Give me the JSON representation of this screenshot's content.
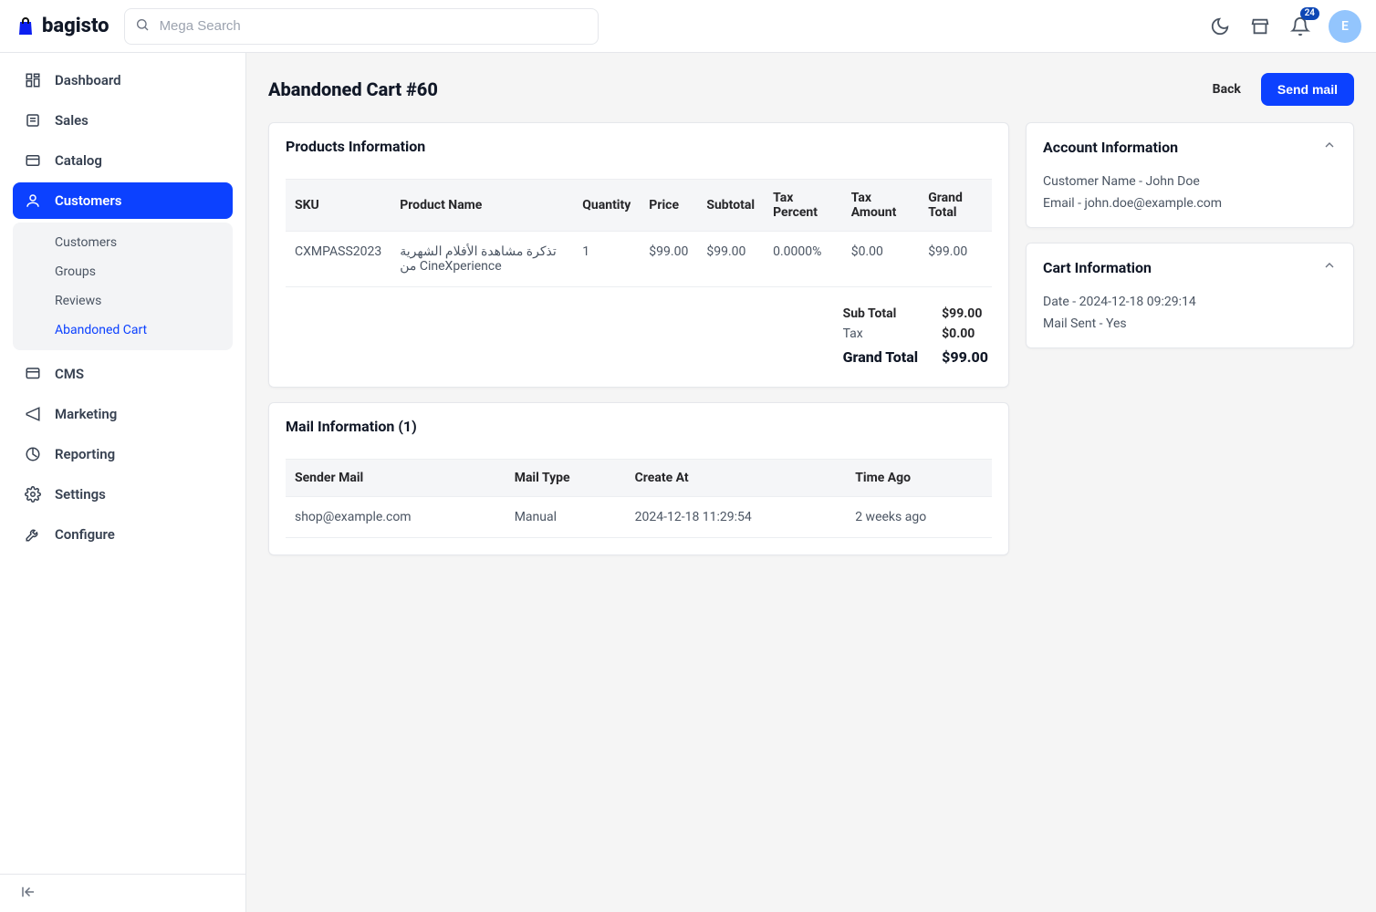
{
  "brand": "bagisto",
  "search": {
    "placeholder": "Mega Search"
  },
  "notifications": {
    "count": "24"
  },
  "avatar_initial": "E",
  "sidebar": {
    "items": [
      {
        "label": "Dashboard"
      },
      {
        "label": "Sales"
      },
      {
        "label": "Catalog"
      },
      {
        "label": "Customers"
      },
      {
        "label": "CMS"
      },
      {
        "label": "Marketing"
      },
      {
        "label": "Reporting"
      },
      {
        "label": "Settings"
      },
      {
        "label": "Configure"
      }
    ],
    "customers_sub": [
      {
        "label": "Customers"
      },
      {
        "label": "Groups"
      },
      {
        "label": "Reviews"
      },
      {
        "label": "Abandoned Cart"
      }
    ]
  },
  "page": {
    "title": "Abandoned Cart #60",
    "back": "Back",
    "send_mail": "Send mail"
  },
  "products": {
    "heading": "Products Information",
    "columns": {
      "sku": "SKU",
      "name": "Product Name",
      "qty": "Quantity",
      "price": "Price",
      "subtotal": "Subtotal",
      "tax_pct": "Tax Percent",
      "tax_amt": "Tax Amount",
      "grand": "Grand Total"
    },
    "rows": [
      {
        "sku": "CXMPASS2023",
        "name": "تذكرة مشاهدة الأفلام الشهرية من CineXperience",
        "qty": "1",
        "price": "$99.00",
        "subtotal": "$99.00",
        "tax_pct": "0.0000%",
        "tax_amt": "$0.00",
        "grand": "$99.00"
      }
    ],
    "totals": {
      "sub_total_label": "Sub Total",
      "sub_total_value": "$99.00",
      "tax_label": "Tax",
      "tax_value": "$0.00",
      "grand_label": "Grand Total",
      "grand_value": "$99.00"
    }
  },
  "mail": {
    "heading": "Mail Information (1)",
    "columns": {
      "sender": "Sender Mail",
      "type": "Mail Type",
      "created": "Create At",
      "ago": "Time Ago"
    },
    "rows": [
      {
        "sender": "shop@example.com",
        "type": "Manual",
        "created": "2024-12-18 11:29:54",
        "ago": "2 weeks ago"
      }
    ]
  },
  "account": {
    "heading": "Account Information",
    "customer_line": "Customer Name - John Doe",
    "email_line": "Email - john.doe@example.com"
  },
  "cart": {
    "heading": "Cart Information",
    "date_line": "Date - 2024-12-18 09:29:14",
    "mail_sent_line": "Mail Sent - Yes"
  }
}
